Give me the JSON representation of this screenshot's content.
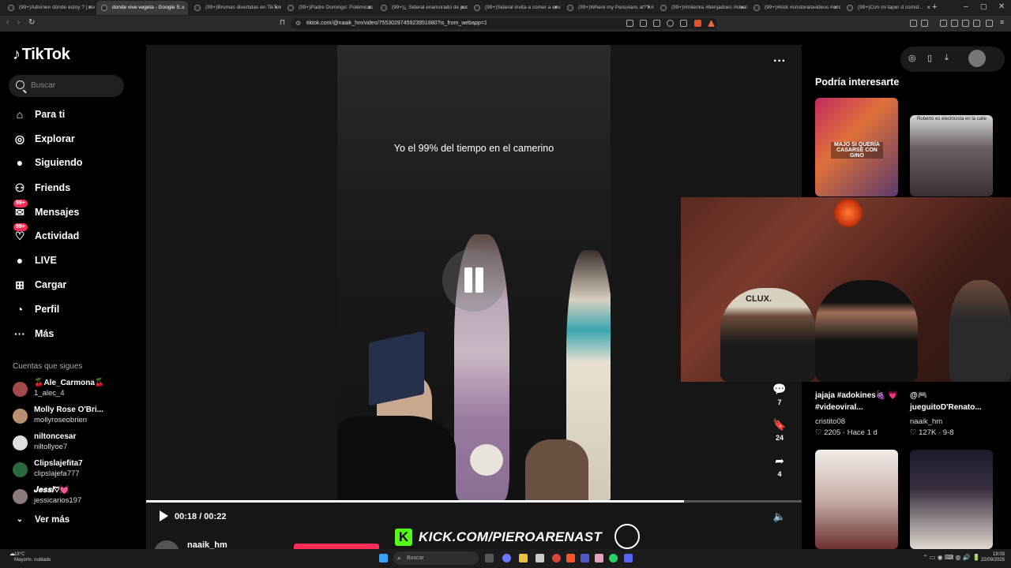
{
  "browser": {
    "tabs": [
      {
        "label": "(99+)Adivinen dónde estoy ? | riso"
      },
      {
        "label": "donde vive vegeta - Google S..."
      },
      {
        "label": "(99+)Bromas divertidas en TikTok..."
      },
      {
        "label": "(99+)Padre Domingo: Polémicas y..."
      },
      {
        "label": "(99+)¿ Sideral enamorado de pati..."
      },
      {
        "label": "(99+)Sideral invita a comer a envi..."
      },
      {
        "label": "(99+)Where my Peruvians at?? #p..."
      },
      {
        "label": "(99+)#milenka #benjadoes #ideal..."
      },
      {
        "label": "(99+)#kick #cristoratavideos #cris..."
      },
      {
        "label": "(99+)Con mi taper d comid..."
      }
    ],
    "active_tab_index": 1,
    "url": "tiktok.com/@naaik_hm/video/7553029745923951880?is_from_webapp=1"
  },
  "sidebar": {
    "logo": "TikTok",
    "search_placeholder": "Buscar",
    "nav": [
      {
        "label": "Para ti",
        "icon": "home-icon"
      },
      {
        "label": "Explorar",
        "icon": "compass-icon"
      },
      {
        "label": "Siguiendo",
        "icon": "avatar-icon"
      },
      {
        "label": "Friends",
        "icon": "friends-icon"
      },
      {
        "label": "Mensajes",
        "icon": "message-icon",
        "badge": "99+"
      },
      {
        "label": "Actividad",
        "icon": "activity-icon",
        "badge": "99+"
      },
      {
        "label": "LIVE",
        "icon": "live-icon"
      },
      {
        "label": "Cargar",
        "icon": "upload-icon"
      },
      {
        "label": "Perfil",
        "icon": "profile-icon"
      },
      {
        "label": "Más",
        "icon": "more-icon"
      }
    ],
    "following_title": "Cuentas que sigues",
    "following": [
      {
        "name": "🍒Ale_Carmona🍒",
        "handle": "1_alec_4"
      },
      {
        "name": "Molly Rose O'Bri...",
        "handle": "mollyroseobrien"
      },
      {
        "name": "niltoncesar",
        "handle": "niltollyoe7"
      },
      {
        "name": "Clipslajefita7",
        "handle": "clipslajefa777"
      },
      {
        "name": "𝑱𝒆𝒔𝒔𝒊♡💓",
        "handle": "jessicarios197"
      }
    ],
    "see_more": "Ver más"
  },
  "video": {
    "caption": "Yo el 99% del tiempo en el camerino",
    "time": "00:18 / 00:22",
    "progress": 0.82,
    "author": "naaik_hm",
    "actions": [
      {
        "icon": "comment-icon",
        "count": "7"
      },
      {
        "icon": "bookmark-icon",
        "count": "24"
      },
      {
        "icon": "share-icon",
        "count": "4"
      }
    ]
  },
  "recommendations": {
    "title": "Podría interesarte",
    "items": [
      {
        "caption": "jajaja #adokines🍇 💗#videoviral...",
        "author": "cristito08",
        "likes": "2205",
        "date": "Hace 1 d"
      },
      {
        "caption": "@🎮 jueguitoD'Renato...",
        "author": "naaik_hm",
        "likes": "127K",
        "date": "9-8"
      }
    ],
    "thumb_texts": [
      "MAJO SI QUERÍA CASARSE CON GINO",
      "Roberto es electricista en la calle"
    ]
  },
  "overlay": {
    "kick_text": "KICK.COM/PIEROARENAST",
    "cap_text": "CLUX."
  },
  "taskbar": {
    "weather_temp": "18°C",
    "weather_desc": "Mayorm. nublado",
    "search_placeholder": "Buscar",
    "time": "19:03",
    "date": "22/09/2025"
  }
}
